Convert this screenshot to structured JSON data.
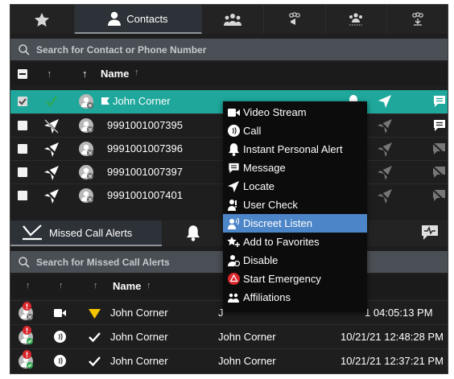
{
  "tabs": {
    "contacts_label": "Contacts"
  },
  "contacts_search": {
    "placeholder": "Search for Contact or Phone Number"
  },
  "contacts_header": {
    "name": "Name"
  },
  "contacts": [
    {
      "name": "John Corner",
      "selected": true
    },
    {
      "name": "9991001007395",
      "selected": false
    },
    {
      "name": "9991001007396",
      "selected": false
    },
    {
      "name": "9991001007397",
      "selected": false
    },
    {
      "name": "9991001007401",
      "selected": false
    }
  ],
  "lower_tabs": {
    "missed_call_alerts_label": "Missed Call Alerts"
  },
  "alerts_search": {
    "placeholder": "Search for Missed Call Alerts"
  },
  "alerts_header": {
    "name": "Name"
  },
  "alerts": [
    {
      "name": "John Corner",
      "user": "J",
      "time": "1 04:05:13 PM"
    },
    {
      "name": "John Corner",
      "user": "John Corner",
      "time": "10/21/21 12:48:28 PM"
    },
    {
      "name": "John Corner",
      "user": "John Corner",
      "time": "10/21/21 12:37:21 PM"
    }
  ],
  "context_menu": {
    "items": [
      {
        "label": "Video Stream",
        "icon": "video-camera-icon"
      },
      {
        "label": "Call",
        "icon": "call-icon"
      },
      {
        "label": "Instant Personal Alert",
        "icon": "bell-icon"
      },
      {
        "label": "Message",
        "icon": "message-icon"
      },
      {
        "label": "Locate",
        "icon": "locate-arrow-icon"
      },
      {
        "label": "User Check",
        "icon": "user-check-icon"
      },
      {
        "label": "Discreet Listen",
        "icon": "discreet-listen-icon",
        "highlighted": true
      },
      {
        "label": "Add to Favorites",
        "icon": "favorite-star-icon"
      },
      {
        "label": "Disable",
        "icon": "disable-user-icon"
      },
      {
        "label": "Start Emergency",
        "icon": "emergency-icon"
      },
      {
        "label": "Affiliations",
        "icon": "affiliations-icon"
      }
    ]
  },
  "colors": {
    "selected_row": "#1fa79b",
    "menu_highlight": "#4d86c8",
    "emergency": "#d9262c",
    "warning_triangle": "#f5c400",
    "status_green": "#2fa84f"
  }
}
